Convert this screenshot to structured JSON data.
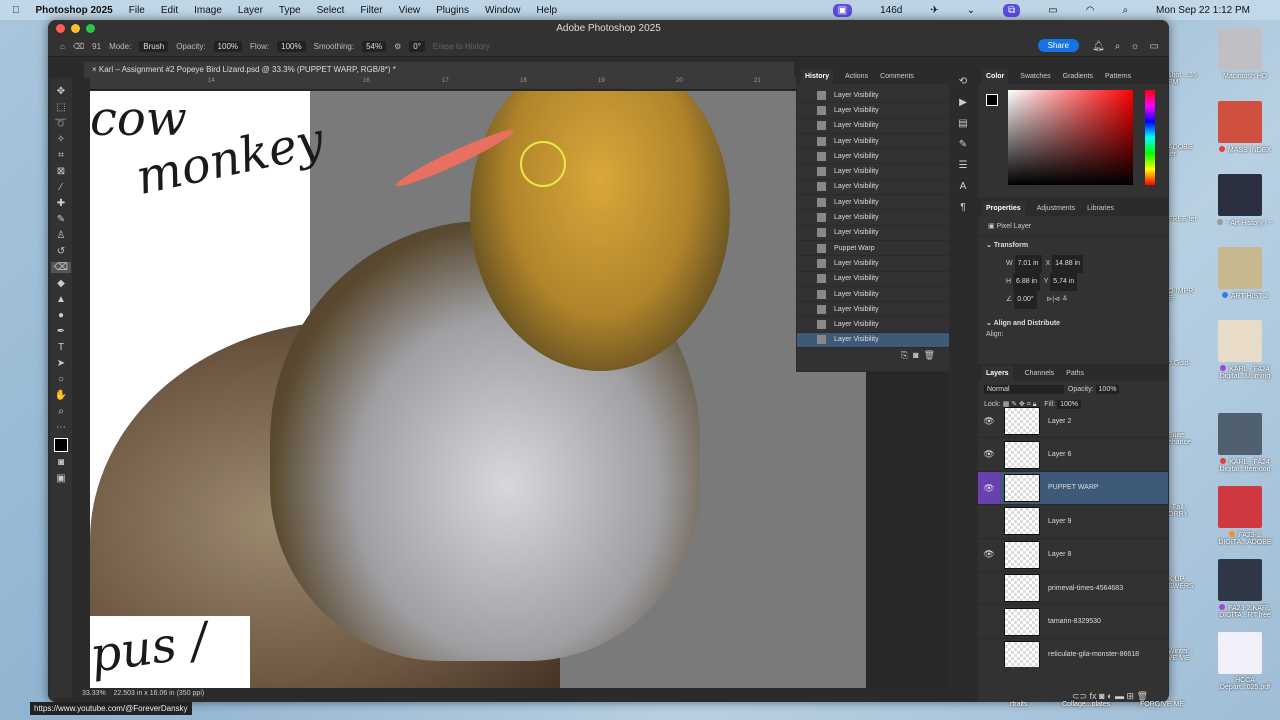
{
  "menubar": {
    "app": "Photoshop 2025",
    "items": [
      "File",
      "Edit",
      "Image",
      "Layer",
      "Type",
      "Select",
      "Filter",
      "View",
      "Plugins",
      "Window",
      "Help"
    ],
    "status_count": "146d",
    "clock": "Mon Sep 22  1:12 PM"
  },
  "window": {
    "title": "Adobe Photoshop 2025",
    "share": "Share"
  },
  "options": {
    "brush_size": "91",
    "mode_label": "Mode:",
    "mode": "Brush",
    "opacity_label": "Opacity:",
    "opacity": "100%",
    "flow_label": "Flow:",
    "flow": "100%",
    "smoothing_label": "Smoothing:",
    "smoothing": "54%",
    "angle": "0°",
    "erase_to_history": "Erase to History"
  },
  "document": {
    "tab": "Karl – Assignment #2 Popeye Bird Lizard.psd @ 33.3% (PUPPET WARP, RGB/8*) *",
    "canvas_text": [
      "cow",
      "monkey",
      "pus /"
    ],
    "zoom": "33.33%",
    "doc_size": "22.503 in x 16.06 in (350 ppi)"
  },
  "ruler": [
    "14",
    "16",
    "17",
    "18",
    "19",
    "20",
    "21"
  ],
  "history": {
    "tabs": [
      "History",
      "Actions",
      "Comments"
    ],
    "items": [
      "Layer Visibility",
      "Layer Visibility",
      "Layer Visibility",
      "Layer Visibility",
      "Layer Visibility",
      "Layer Visibility",
      "Layer Visibility",
      "Layer Visibility",
      "Layer Visibility",
      "Layer Visibility",
      "Puppet Warp",
      "Layer Visibility",
      "Layer Visibility",
      "Layer Visibility",
      "Layer Visibility",
      "Layer Visibility",
      "Layer Visibility"
    ]
  },
  "color": {
    "tabs": [
      "Color",
      "Swatches",
      "Gradients",
      "Patterns"
    ],
    "hue": "#ff0000"
  },
  "properties": {
    "tabs": [
      "Properties",
      "Adjustments",
      "Libraries"
    ],
    "kind": "Pixel Layer",
    "transform": "Transform",
    "w": "7.01 in",
    "h": "6.88 in",
    "x": "14.88 in",
    "y": "5.74 in",
    "angle": "0.00°",
    "align": "Align and Distribute",
    "align_label": "Align:"
  },
  "layers": {
    "tabs": [
      "Layers",
      "Channels",
      "Paths"
    ],
    "blend": "Normal",
    "opacity_label": "Opacity:",
    "opacity": "100%",
    "lock_label": "Lock:",
    "fill_label": "Fill:",
    "fill": "100%",
    "items": [
      {
        "name": "Layer 2",
        "visible": true
      },
      {
        "name": "Layer 6",
        "visible": true
      },
      {
        "name": "PUPPET WARP",
        "visible": true,
        "selected": true
      },
      {
        "name": "Layer 9",
        "visible": false
      },
      {
        "name": "Layer 8",
        "visible": true
      },
      {
        "name": "primeval-times-4564683",
        "visible": false
      },
      {
        "name": "tamarin-8329530",
        "visible": false
      },
      {
        "name": "reticulate-gila-monster-86618",
        "visible": false
      }
    ]
  },
  "desktop": {
    "right": [
      {
        "label": "Macintosh HD"
      },
      {
        "label": "MASS INDEX",
        "dot": "#e04040"
      },
      {
        "label": "~Art History I ~",
        "dot": "#999999"
      },
      {
        "label": "ART HIST 2",
        "dot": "#3b7be0"
      },
      {
        "label": "KARL - FA24 Digital...Morning",
        "dot": "#b040d0"
      },
      {
        "label": "KARL - FA24 Digital...fternoon",
        "dot": "#e04040"
      },
      {
        "label": "FA23-1 DIGITA...ADOBE",
        "dot": "#f0902a"
      },
      {
        "label": "FA23-2 KARL DIGITA...RT  free",
        "dot": "#b040d0"
      },
      {
        "label": "HCCA Depart...025.pdf"
      }
    ],
    "partial": [
      "shot ...35 PM",
      "ADOBE ter",
      "FREE ter",
      "O-IMPR E-",
      "d Gold",
      "Suite ehance",
      "- Fall - ORRY",
      "K UP SWERS",
      "Winter - VE ME"
    ],
    "bottom": [
      "rtraits",
      "Collage...plates",
      "FORGIVE ME"
    ]
  },
  "tooltip": "https://www.youtube.com/@ForeverDansky"
}
